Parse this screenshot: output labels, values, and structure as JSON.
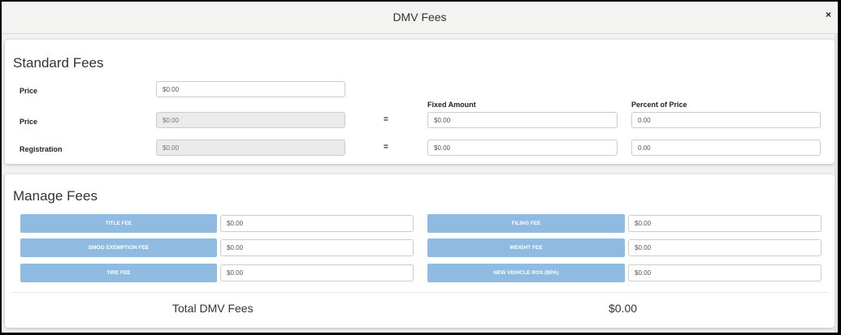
{
  "modal": {
    "title": "DMV Fees",
    "close_label": "×"
  },
  "standard": {
    "title": "Standard Fees",
    "price_label": "Price",
    "price_value": "$0.00",
    "fixed_amount_header": "Fixed Amount",
    "percent_header": "Percent of Price",
    "rows": [
      {
        "label": "Price",
        "base": "$0.00",
        "eq": "=",
        "fixed": "$0.00",
        "percent": "0.00"
      },
      {
        "label": "Registration",
        "base": "$0.00",
        "eq": "=",
        "fixed": "$0.00",
        "percent": "0.00"
      }
    ]
  },
  "manage": {
    "title": "Manage Fees",
    "left": [
      {
        "label": "TITLE FEE",
        "value": "$0.00"
      },
      {
        "label": "SMOG EXEMPTION FEE",
        "value": "$0.00"
      },
      {
        "label": "TIRE FEE",
        "value": "$0.00"
      }
    ],
    "right": [
      {
        "label": "FILING FEE",
        "value": "$0.00"
      },
      {
        "label": "WEIGHT FEE",
        "value": "$0.00"
      },
      {
        "label": "NEW VEHICLE ROS (BPA)",
        "value": "$0.00"
      }
    ],
    "total_label": "Total DMV Fees",
    "total_value": "$0.00"
  },
  "colors": {
    "fee_button": "#8fbbe3",
    "background": "#f3f3f1"
  }
}
